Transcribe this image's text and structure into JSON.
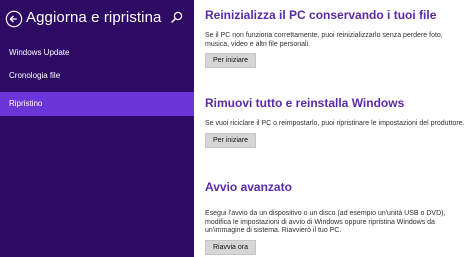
{
  "sidebar": {
    "title": "Aggiorna e ripristina",
    "back_icon": "back-arrow-icon",
    "search_icon": "search-icon",
    "background": "#2d0b64",
    "selected_background": "#6b35d8",
    "items": [
      {
        "label": "Windows Update",
        "selected": false
      },
      {
        "label": "Cronologia file",
        "selected": false
      },
      {
        "label": "Ripristino",
        "selected": true
      }
    ]
  },
  "main": {
    "accent": "#5b2aa7",
    "sections": [
      {
        "title": "Reinizializza il PC conservando i tuoi file",
        "description": "Se il PC non funziona correttamente, puoi reinizializzarlo senza perdere foto, musica, video e altri file personali.",
        "button": "Per iniziare"
      },
      {
        "title": "Rimuovi tutto e reinstalla Windows",
        "description": "Se vuoi riciclare il PC o reimpostarlo, puoi ripristinare le impostazioni del produttore.",
        "button": "Per iniziare"
      },
      {
        "title": "Avvio avanzato",
        "description": "Esegui l'avvio da un dispositivo o un disco (ad esempio un'unità USB o DVD), modifica le impostazioni di avvio di Windows oppure ripristina Windows da un'immagine di sistema. Riavvierò il tuo PC.",
        "button": "Riavvia ora"
      }
    ]
  }
}
